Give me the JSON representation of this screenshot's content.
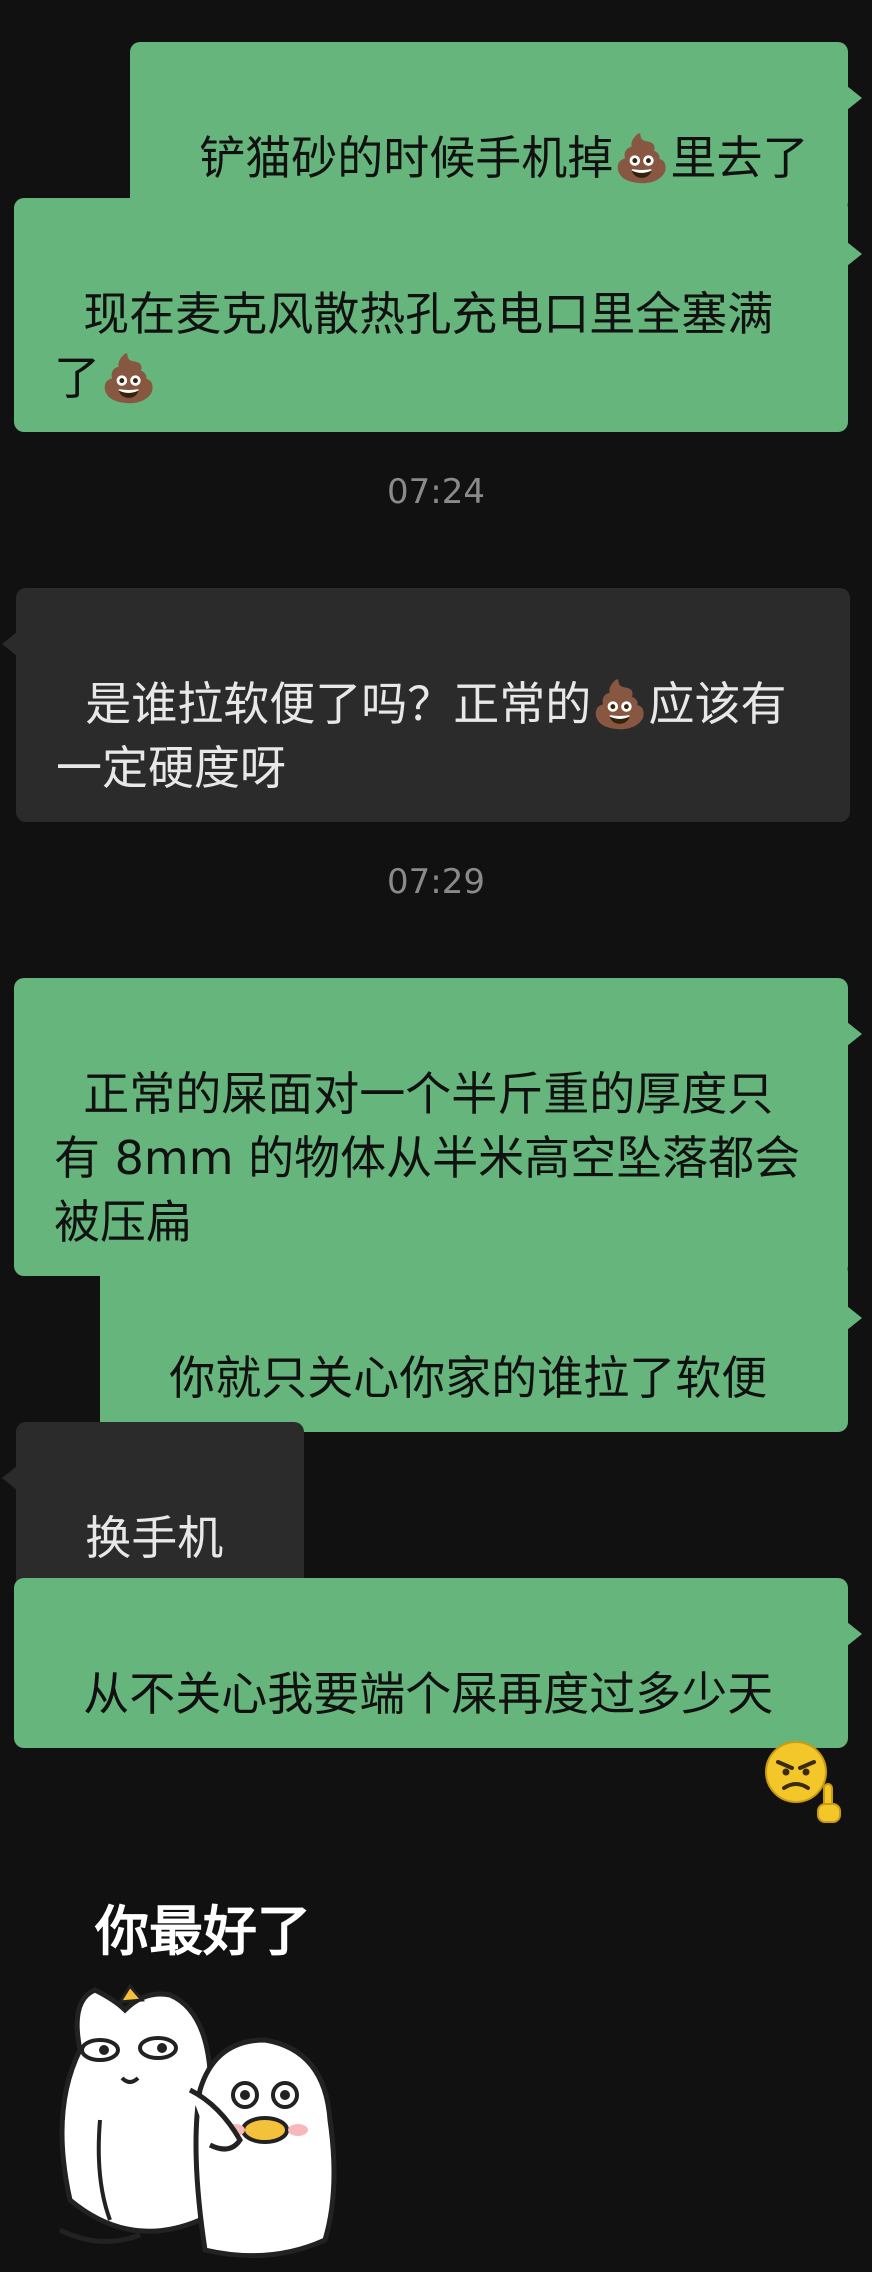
{
  "messages": [
    {
      "id": "m1",
      "side": "sent",
      "text": "铲猫砂的时候手机掉💩里去了"
    },
    {
      "id": "m2",
      "side": "sent",
      "text": "现在麦克风散热孔充电口里全塞满了💩"
    },
    {
      "id": "m3",
      "side": "recv",
      "text": "是谁拉软便了吗？正常的💩应该有一定硬度呀"
    },
    {
      "id": "m4",
      "side": "sent",
      "text": "正常的屎面对一个半斤重的厚度只有 8mm 的物体从半米高空坠落都会被压扁"
    },
    {
      "id": "m5",
      "side": "sent",
      "text": "你就只关心你家的谁拉了软便"
    },
    {
      "id": "m6",
      "side": "recv",
      "text": "换手机🤫"
    },
    {
      "id": "m7",
      "side": "sent",
      "text": "从不关心我要端个屎再度过多少天"
    }
  ],
  "timestamps": [
    "07:24",
    "07:29"
  ],
  "emoji_message": {
    "icon": "angry-middle-finger-emoji"
  },
  "sticker": {
    "caption": "你最好了",
    "icon": "cat-hugging-duck-sticker"
  }
}
